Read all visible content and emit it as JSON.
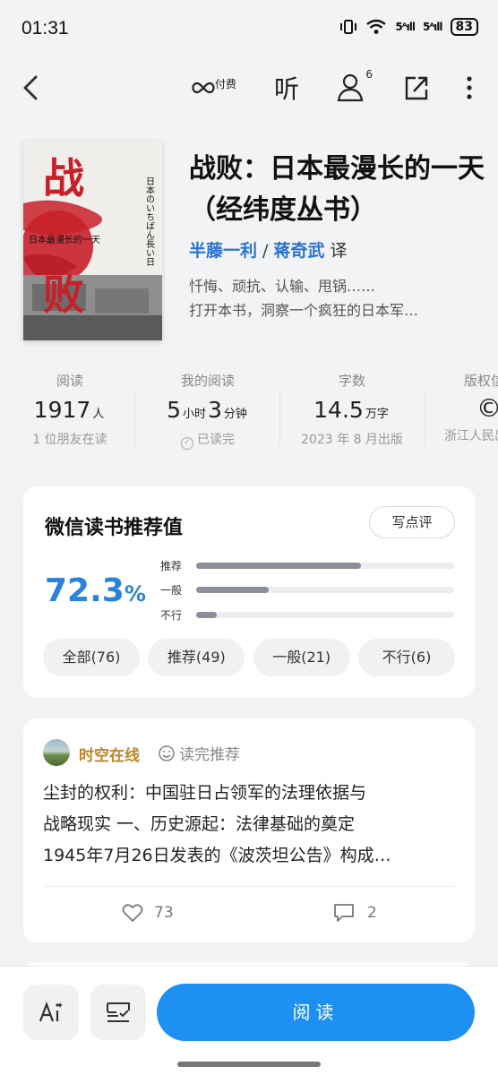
{
  "status": {
    "time": "01:31",
    "battery": "83",
    "sig1": "5ᴬıll",
    "sig2": "5ᴬıll"
  },
  "topbar": {
    "pay_label": "付费",
    "listen_label": "听",
    "friend_count": "6"
  },
  "book": {
    "title": "战败：日本最漫长的一天（经纬度丛书）",
    "author1": "半藤一利",
    "author_sep": " / ",
    "author2": "蒋奇武",
    "author_role": " 译",
    "desc_line1": "忏悔、顽抗、认输、甩锅……",
    "desc_line2": "打开本书，洞察一个疯狂的日本军…",
    "cover": {
      "big1": "战",
      "big2": "败",
      "jp_side": "日本のいちばん長い日",
      "cn_small": "日本最漫长的一天"
    }
  },
  "stats": {
    "reads": {
      "label": "阅读",
      "value": "1917",
      "unit": "人",
      "sub": "1 位朋友在读"
    },
    "my_reading": {
      "label": "我的阅读",
      "hours": "5",
      "hours_unit": "小时",
      "minutes": "3",
      "minutes_unit": "分钟",
      "sub": "已读完"
    },
    "words": {
      "label": "字数",
      "value": "14.5",
      "unit": "万字",
      "sub": "2023 年 8 月出版"
    },
    "copyright": {
      "label": "版权信息",
      "value": "©",
      "sub": "浙江人民出版社"
    }
  },
  "recommend": {
    "title": "微信读书推荐值",
    "write_review": "写点评",
    "score": "72.3",
    "score_unit": "%",
    "bars": [
      {
        "label": "推荐",
        "fraction": 0.64
      },
      {
        "label": "一般",
        "fraction": 0.28
      },
      {
        "label": "不行",
        "fraction": 0.08
      }
    ],
    "chips": [
      "全部(76)",
      "推荐(49)",
      "一般(21)",
      "不行(6)"
    ]
  },
  "review": {
    "user": "时空在线",
    "tag": "读完推荐",
    "lines": [
      "尘封的权利：中国驻日占领军的法理依据与",
      "战略现实 一、历史源起：法律基础的奠定",
      "1945年7月26日发表的《波茨坦公告》构成…"
    ],
    "likes": "73",
    "comments": "2"
  },
  "bottom": {
    "read_label": "阅读"
  },
  "colors": {
    "accent": "#1e8ff3",
    "score": "#2b82d9",
    "author": "#2b72d1",
    "reviewer": "#b8862c"
  }
}
